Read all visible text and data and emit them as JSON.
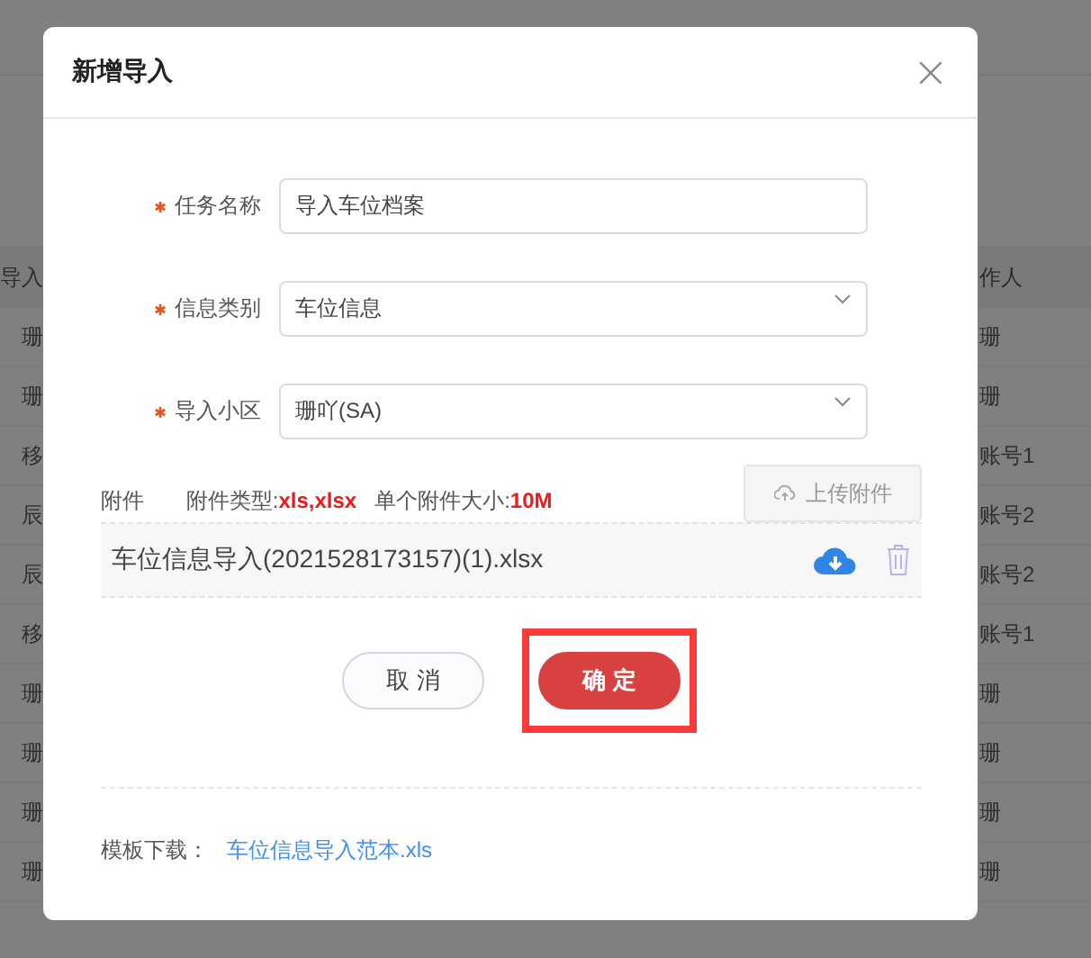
{
  "background_table": {
    "left_column": [
      "导入",
      "珊",
      "珊",
      "移",
      "辰",
      "辰",
      "移",
      "珊",
      "珊",
      "珊",
      "珊"
    ],
    "right_column": [
      "作人",
      "珊",
      "珊",
      "账号1",
      "账号2",
      "账号2",
      "账号1",
      "珊",
      "珊",
      "珊",
      "珊"
    ]
  },
  "dialog": {
    "title": "新增导入",
    "close": "×",
    "fields": [
      {
        "label": "任务名称",
        "required": true,
        "kind": "input",
        "value": "导入车位档案"
      },
      {
        "label": "信息类别",
        "required": true,
        "kind": "select",
        "value": "车位信息"
      },
      {
        "label": "导入小区",
        "required": true,
        "kind": "select",
        "value": "珊吖(SA)"
      }
    ],
    "attachment": {
      "label": "附件",
      "type_label": "附件类型:",
      "types": "xls,xlsx",
      "size_label": "单个附件大小:",
      "size": "10M",
      "upload_button": {
        "label": "上传附件",
        "disabled": true
      },
      "files": [
        {
          "name": "车位信息导入(2021528173157)(1).xlsx"
        }
      ]
    },
    "buttons": [
      {
        "label": "取 消",
        "kind": "secondary",
        "highlighted": false
      },
      {
        "label": "确 定",
        "kind": "primary",
        "highlighted": true
      }
    ],
    "template": {
      "label": "模板下载：",
      "link": "车位信息导入范本.xls"
    }
  }
}
